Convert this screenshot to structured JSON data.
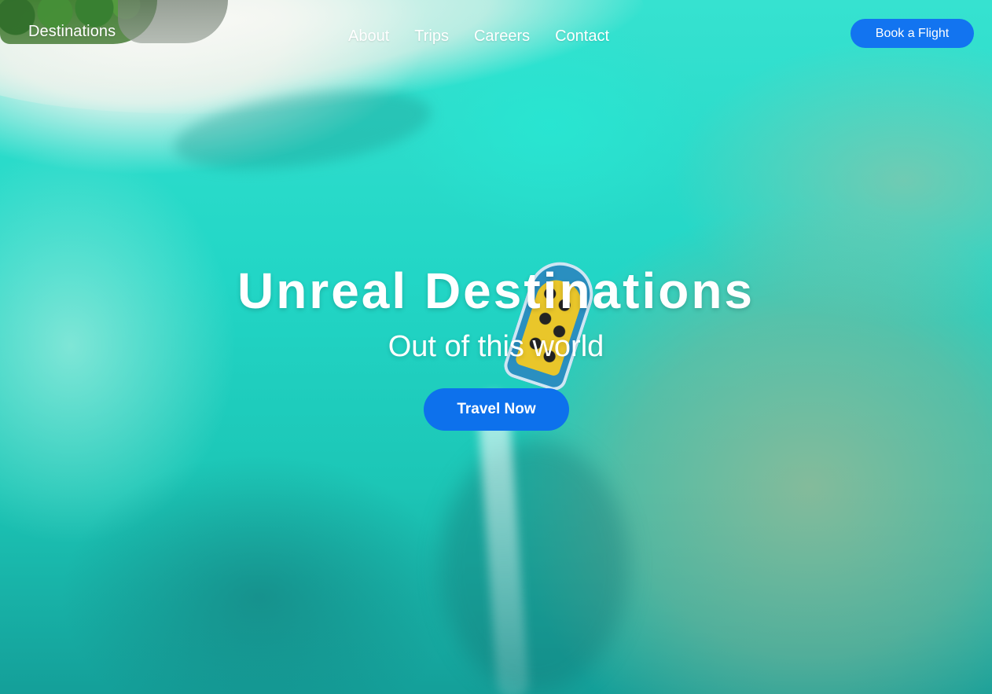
{
  "nav": {
    "logo": "Destinations",
    "links": [
      {
        "label": "About"
      },
      {
        "label": "Trips"
      },
      {
        "label": "Careers"
      },
      {
        "label": "Contact"
      }
    ],
    "cta_label": "Book a Flight"
  },
  "hero": {
    "title": "Unreal Destinations",
    "subtitle": "Out of this world",
    "cta_label": "Travel Now",
    "background": "aerial-lagoon-boat-image"
  },
  "colors": {
    "button_blue": "#1274f0",
    "text": "#ffffff",
    "water": "#22d6c6"
  }
}
